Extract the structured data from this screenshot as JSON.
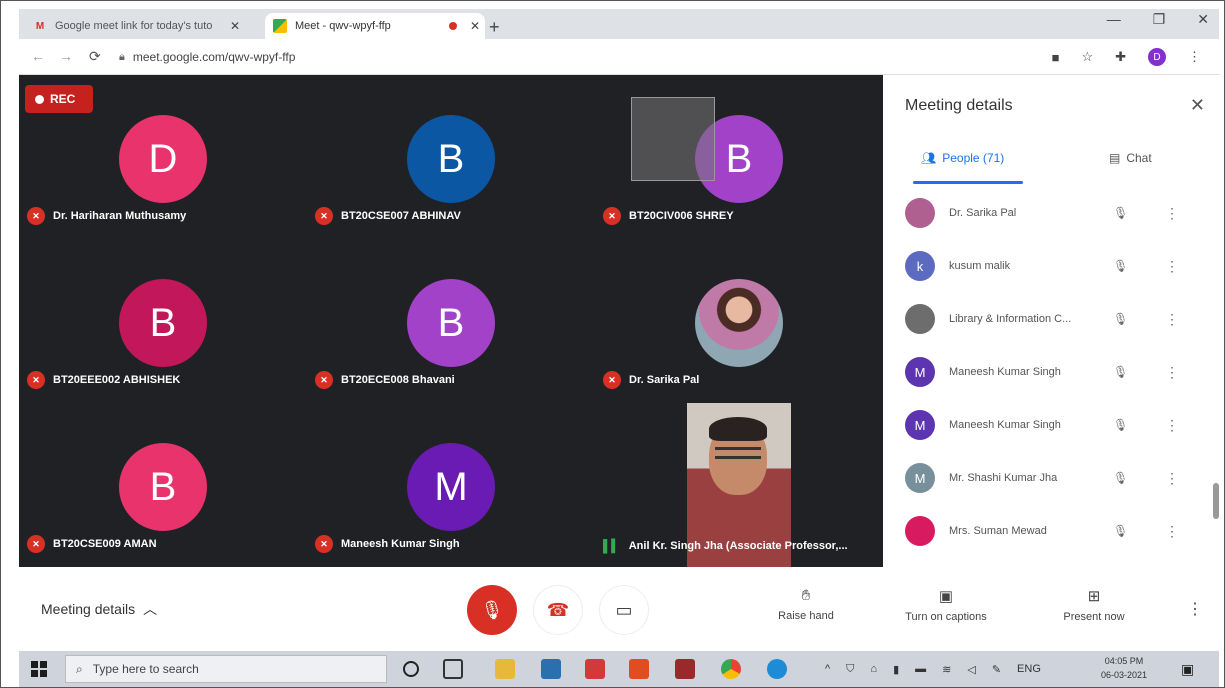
{
  "browser": {
    "tabs": [
      {
        "title": "Google meet link for today's tuto",
        "favicon": "gmail-icon",
        "active": false
      },
      {
        "title": "Meet - qwv-wpyf-ffp",
        "favicon": "meet-icon",
        "active": true
      }
    ],
    "url": "meet.google.com/qwv-wpyf-ffp",
    "profile_initial": "D"
  },
  "meeting": {
    "rec_label": "REC",
    "tiles": [
      {
        "type": "avatar",
        "initial": "D",
        "color": "#e8336d",
        "name": "Dr. Hariharan Muthusamy"
      },
      {
        "type": "avatar",
        "initial": "B",
        "color": "#0b57a4",
        "name": "BT20CSE007 ABHINAV"
      },
      {
        "type": "avatar",
        "initial": "B",
        "color": "#a142c9",
        "name": "BT20CIV006 SHREY"
      },
      {
        "type": "avatar",
        "initial": "B",
        "color": "#c2185b",
        "name": "BT20EEE002 ABHISHEK"
      },
      {
        "type": "avatar",
        "initial": "B",
        "color": "#a142c9",
        "name": "BT20ECE008 Bhavani"
      },
      {
        "type": "photo",
        "initial": "",
        "color": "",
        "name": "Dr. Sarika Pal"
      },
      {
        "type": "avatar",
        "initial": "B",
        "color": "#e8336d",
        "name": "BT20CSE009 AMAN"
      },
      {
        "type": "avatar",
        "initial": "M",
        "color": "#6a1bb3",
        "name": "Maneesh Kumar Singh"
      },
      {
        "type": "video",
        "initial": "",
        "color": "",
        "name": "Anil Kr. Singh Jha (Associate Professor,..."
      }
    ]
  },
  "panel": {
    "title": "Meeting details",
    "people_tab": "People (71)",
    "chat_tab": "Chat",
    "people": [
      {
        "name": "Dr. Sarika Pal",
        "initial": "",
        "color": "#b06090"
      },
      {
        "name": "kusum malik",
        "initial": "k",
        "color": "#5c6bc0"
      },
      {
        "name": "Library & Information C...",
        "initial": "",
        "color": "#6d6d6d"
      },
      {
        "name": "Maneesh Kumar Singh",
        "initial": "M",
        "color": "#5e35b1"
      },
      {
        "name": "Maneesh Kumar Singh",
        "initial": "M",
        "color": "#5e35b1"
      },
      {
        "name": "Mr. Shashi Kumar Jha",
        "initial": "M",
        "color": "#78909c"
      },
      {
        "name": "Mrs. Suman Mewad",
        "initial": "",
        "color": "#d81b60"
      }
    ]
  },
  "controls": {
    "meeting_details": "Meeting details",
    "raise_hand": "Raise hand",
    "captions": "Turn on captions",
    "present": "Present now"
  },
  "taskbar": {
    "search_placeholder": "Type here to search",
    "lang": "ENG",
    "time": "04:05 PM",
    "date": "06-03-2021"
  }
}
